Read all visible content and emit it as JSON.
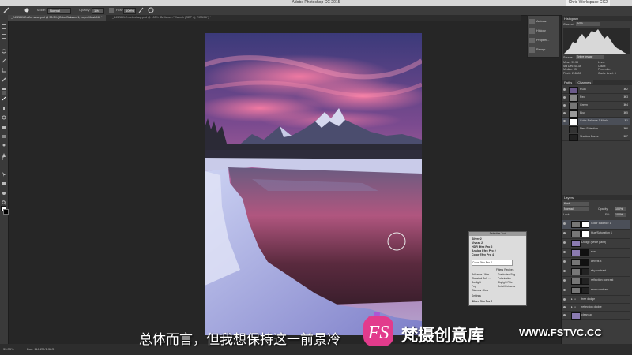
{
  "app": {
    "title": "Adobe Photoshop CC 2015",
    "workspace": "Chris Workspace CC2"
  },
  "options_bar": {
    "mode_label": "Mode:",
    "mode_value": "Normal",
    "opacity_label": "Opacity:",
    "opacity_value": "1%",
    "flow_label": "Flow:",
    "flow_value": "100%"
  },
  "tabs": [
    {
      "label": "_2412861-2-after-wise.psd @ 33.3% (Color Balance 1, Layer Mask/16) *",
      "active": true
    },
    {
      "label": "_2412861-2-web-sharp.psd @ 100% (Brilliance / Warmth (GDP 4), RGB/16*) *",
      "active": false
    }
  ],
  "collapsed_panels": [
    {
      "label": "Actions",
      "icon": "play-icon"
    },
    {
      "label": "History",
      "icon": "history-icon"
    },
    {
      "label": "Properti...",
      "icon": "properties-icon"
    },
    {
      "label": "Paragr...",
      "icon": "paragraph-icon"
    }
  ],
  "histogram": {
    "title": "Histogram",
    "channel_label": "Channel:",
    "channel_value": "RGB",
    "source_label": "Source:",
    "source_value": "Entire Image",
    "stats_left": [
      [
        "Mean:",
        "93.34"
      ],
      [
        "Std Dev:",
        "40.38"
      ],
      [
        "Median:",
        "93"
      ],
      [
        "Pixels:",
        "218600"
      ]
    ],
    "stats_right": [
      [
        "Level:",
        ""
      ],
      [
        "Count:",
        ""
      ],
      [
        "Percentile:",
        ""
      ],
      [
        "Cache Level:",
        "3"
      ]
    ]
  },
  "channels": {
    "tabs": [
      "Paths",
      "Channels"
    ],
    "rows": [
      {
        "name": "RGB",
        "shortcut": "⌘2"
      },
      {
        "name": "Red",
        "shortcut": "⌘3"
      },
      {
        "name": "Green",
        "shortcut": "⌘4"
      },
      {
        "name": "Blue",
        "shortcut": "⌘5"
      },
      {
        "name": "Color Balance 1 Mask",
        "shortcut": "⌘\\"
      },
      {
        "name": "New Selection",
        "shortcut": "⌘6"
      },
      {
        "name": "Shadow Darks",
        "shortcut": "⌘7"
      }
    ]
  },
  "layers": {
    "title": "Layers",
    "kind_label": "Kind",
    "blend_mode": "Normal",
    "opacity_label": "Opacity:",
    "opacity_value": "100%",
    "lock_label": "Lock:",
    "fill_label": "Fill:",
    "fill_value": "100%",
    "rows": [
      {
        "name": "Color Balance 1",
        "selected": true
      },
      {
        "name": "Hue/Saturation 1",
        "selected": false
      },
      {
        "name": "Dodge (white paint)",
        "selected": false
      },
      {
        "name": "sun",
        "selected": false
      },
      {
        "name": "Levels 8",
        "selected": false
      },
      {
        "name": "sky contrast",
        "selected": false
      },
      {
        "name": "reflection contrast",
        "selected": false
      },
      {
        "name": "snow contrast",
        "selected": false
      },
      {
        "name": "tree dodge",
        "selected": false
      },
      {
        "name": "reflection dodge",
        "selected": false
      },
      {
        "name": "clean up",
        "selected": false
      }
    ]
  },
  "nik_panel": {
    "title": "Selective Tool",
    "items": [
      "Silver 2",
      "Viveza 2",
      "HDR Efex Pro 2",
      "Analog Efex Pro 2",
      "Color Efex Pro 4"
    ],
    "recent_label": "Color Efex Pro 4",
    "filters_tabs": [
      "Filters",
      "Recipes"
    ],
    "filters_left": [
      "Brilliance / War...",
      "Classical Soft ...",
      "Sunlight",
      "Fog",
      "Glamour Glow"
    ],
    "filters_right": [
      "Graduated Fog",
      "Polarization",
      "Skylight Filter",
      "Detail Extractor"
    ],
    "settings_label": "Settings",
    "bottom_label": "Silver Efex Pro 2"
  },
  "status": {
    "zoom": "33.33%",
    "doc": "Doc: 116.2M/1.38G"
  },
  "subtitle": {
    "text": "总体而言，但我想保持这一前景冷"
  },
  "watermark": {
    "brand": "梵摄创意库",
    "url": "WWW.FSTVC.CC",
    "logo_letters": "FS"
  },
  "colors": {
    "panel_bg": "#3c3c3c",
    "canvas_bg": "#262626",
    "selection": "#4b4f58",
    "watermark_pink": "#e23b8c"
  }
}
